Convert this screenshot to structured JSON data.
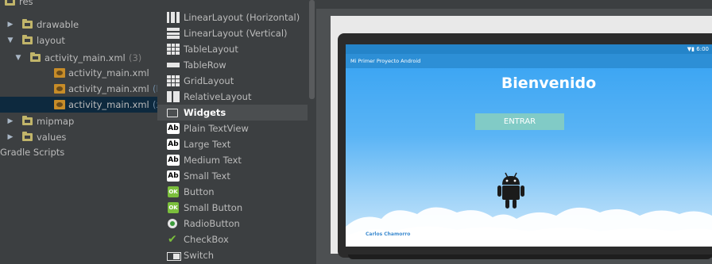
{
  "tree": {
    "items": [
      {
        "label": "res",
        "indent": 0,
        "type": "folder"
      },
      {
        "label": "drawable",
        "indent": 1,
        "type": "folder",
        "arrow": "▶"
      },
      {
        "label": "layout",
        "indent": 1,
        "type": "folder",
        "arrow": "▼"
      },
      {
        "label": "activity_main.xml",
        "count": "(3)",
        "indent": 2,
        "type": "folder",
        "arrow": "▼"
      },
      {
        "label": "activity_main.xml",
        "indent": 3,
        "type": "xml"
      },
      {
        "label": "activity_main.xml",
        "suffix": "(lan",
        "indent": 3,
        "type": "xml"
      },
      {
        "label": "activity_main.xml",
        "suffix": "(xla",
        "indent": 3,
        "type": "xml",
        "selected": true
      },
      {
        "label": "mipmap",
        "indent": 1,
        "type": "folder",
        "arrow": "▶"
      },
      {
        "label": "values",
        "indent": 1,
        "type": "folder",
        "arrow": "▶"
      },
      {
        "label": "Gradle Scripts",
        "indent": 0,
        "type": "text"
      }
    ]
  },
  "palette": {
    "items": [
      {
        "label": "LinearLayout (Horizontal)",
        "icon": "linear-layout-horizontal-icon"
      },
      {
        "label": "LinearLayout (Vertical)",
        "icon": "linear-layout-vertical-icon"
      },
      {
        "label": "TableLayout",
        "icon": "table-layout-icon"
      },
      {
        "label": "TableRow",
        "icon": "table-row-icon"
      },
      {
        "label": "GridLayout",
        "icon": "grid-layout-icon"
      },
      {
        "label": "RelativeLayout",
        "icon": "relative-layout-icon"
      },
      {
        "label": "Widgets",
        "icon": "folder-icon",
        "header": true
      },
      {
        "label": "Plain TextView",
        "icon": "textview-icon",
        "badge": "Ab"
      },
      {
        "label": "Large Text",
        "icon": "large-text-icon",
        "badge": "Ab"
      },
      {
        "label": "Medium Text",
        "icon": "medium-text-icon",
        "badge": "Ab"
      },
      {
        "label": "Small Text",
        "icon": "small-text-icon",
        "badge": "Ab"
      },
      {
        "label": "Button",
        "icon": "button-icon",
        "badge": "OK"
      },
      {
        "label": "Small Button",
        "icon": "small-button-icon",
        "badge": "OK"
      },
      {
        "label": "RadioButton",
        "icon": "radio-button-icon"
      },
      {
        "label": "CheckBox",
        "icon": "checkbox-icon"
      },
      {
        "label": "Switch",
        "icon": "switch-icon"
      }
    ]
  },
  "preview": {
    "status_time": "6:00",
    "app_title": "Mi Primer Proyecto Android",
    "welcome_text": "Bienvenido",
    "enter_button": "ENTRAR",
    "author": "Carlos Chamorro"
  },
  "colors": {
    "ide_bg": "#3c3f41",
    "selection": "#0d293e",
    "folder": "#c1b56a",
    "app_bar": "#2d8fd6",
    "status_bar": "#2484c9",
    "button": "#81cbc6",
    "android_green": "#1b1b1b"
  }
}
